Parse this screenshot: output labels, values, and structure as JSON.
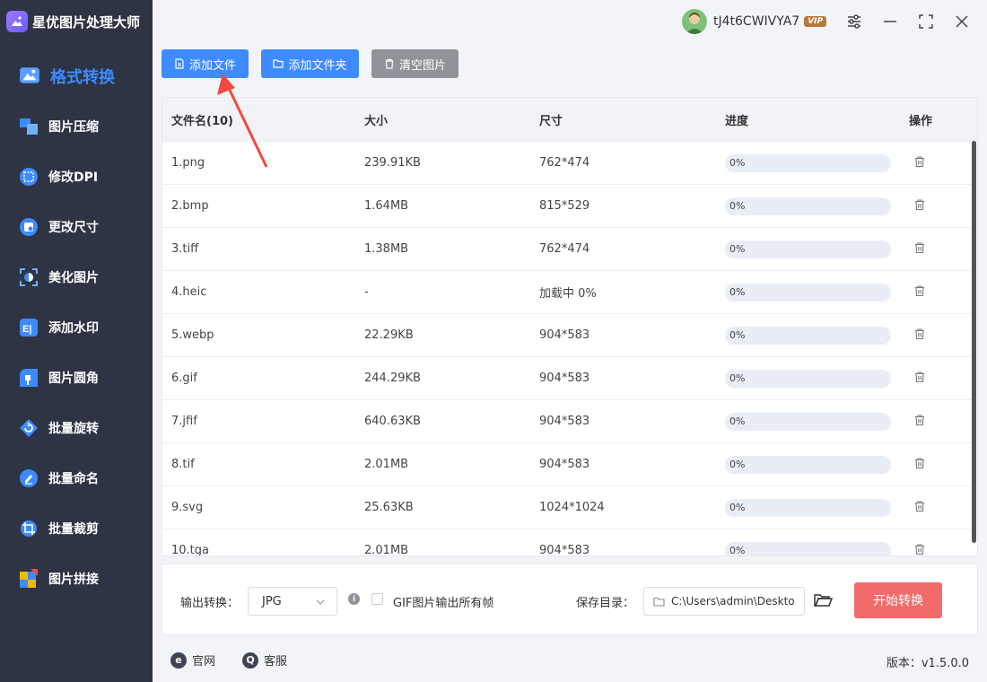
{
  "app": {
    "title": "星优图片处理大师"
  },
  "sidebar": {
    "items": [
      {
        "label": "格式转换",
        "icon": "format-convert-icon",
        "active": true
      },
      {
        "label": "图片压缩",
        "icon": "compress-icon"
      },
      {
        "label": "修改DPI",
        "icon": "dpi-icon"
      },
      {
        "label": "更改尺寸",
        "icon": "resize-icon"
      },
      {
        "label": "美化图片",
        "icon": "beautify-icon"
      },
      {
        "label": "添加水印",
        "icon": "watermark-icon"
      },
      {
        "label": "图片圆角",
        "icon": "round-corner-icon"
      },
      {
        "label": "批量旋转",
        "icon": "rotate-icon"
      },
      {
        "label": "批量命名",
        "icon": "rename-icon"
      },
      {
        "label": "批量裁剪",
        "icon": "crop-icon"
      },
      {
        "label": "图片拼接",
        "icon": "stitch-icon"
      }
    ]
  },
  "user": {
    "name": "tJ4t6CWIVYA7",
    "badge": "VIP"
  },
  "toolbar": {
    "add_file": "添加文件",
    "add_folder": "添加文件夹",
    "clear": "清空图片"
  },
  "table": {
    "headers": {
      "name": "文件名(10)",
      "size": "大小",
      "dim": "尺寸",
      "progress": "进度",
      "op": "操作"
    },
    "rows": [
      {
        "name": "1.png",
        "size": "239.91KB",
        "dim": "762*474",
        "progress": "0%"
      },
      {
        "name": "2.bmp",
        "size": "1.64MB",
        "dim": "815*529",
        "progress": "0%"
      },
      {
        "name": "3.tiff",
        "size": "1.38MB",
        "dim": "762*474",
        "progress": "0%"
      },
      {
        "name": "4.heic",
        "size": "-",
        "dim": "加载中 0%",
        "progress": "0%"
      },
      {
        "name": "5.webp",
        "size": "22.29KB",
        "dim": "904*583",
        "progress": "0%"
      },
      {
        "name": "6.gif",
        "size": "244.29KB",
        "dim": "904*583",
        "progress": "0%"
      },
      {
        "name": "7.jfif",
        "size": "640.63KB",
        "dim": "904*583",
        "progress": "0%"
      },
      {
        "name": "8.tif",
        "size": "2.01MB",
        "dim": "904*583",
        "progress": "0%"
      },
      {
        "name": "9.svg",
        "size": "25.63KB",
        "dim": "1024*1024",
        "progress": "0%"
      },
      {
        "name": "10.tga",
        "size": "2.01MB",
        "dim": "904*583",
        "progress": "0%"
      }
    ]
  },
  "bottom": {
    "output_label": "输出转换：",
    "format_value": "JPG",
    "gif_option": "GIF图片输出所有帧",
    "save_label": "保存目录：",
    "save_path": "C:\\Users\\admin\\Deskto",
    "start_button": "开始转换"
  },
  "footer": {
    "website": "官网",
    "support": "客服",
    "version": "版本：v1.5.0.0"
  },
  "colors": {
    "accent": "#3d8bff",
    "sidebar_bg": "#2e3444",
    "start_button": "#f26b6b",
    "annotation_arrow": "#f04a3e"
  }
}
